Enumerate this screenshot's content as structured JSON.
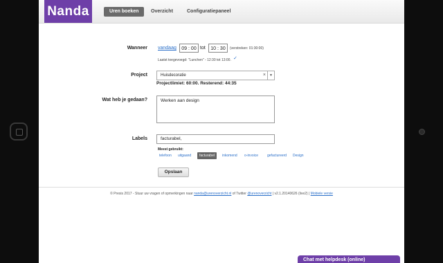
{
  "brand": {
    "logo": "Nanda",
    "accent": "#6e3fa8"
  },
  "nav": {
    "tabs": [
      {
        "label": "Uren boeken",
        "active": true
      },
      {
        "label": "Overzicht",
        "active": false
      },
      {
        "label": "Configuratiepaneel",
        "active": false
      }
    ]
  },
  "form": {
    "when": {
      "label": "Wanneer",
      "date_link": "vandaag",
      "from_h": "09",
      "from_m": "00",
      "to_label": "tot",
      "to_h": "10",
      "to_m": "30",
      "duration": "(verstreken: 01:30:00)",
      "last_added": "Laatst toegevoegd: \"Lunchen\" - 12:30 tot 13:00.",
      "check_icon": "checkmark-icon"
    },
    "project": {
      "label": "Project",
      "value": "Huisdecoratie",
      "limit": "Projectlimiet: 60:00. Resterend: 44:35"
    },
    "description": {
      "label": "Wat heb je gedaan?",
      "value": "Werken aan design"
    },
    "labels": {
      "label": "Labels",
      "value": "facturabel,",
      "most_used_label": "Meest gebruikt:",
      "tags": [
        {
          "text": "telefoon",
          "selected": false
        },
        {
          "text": "uitgaand",
          "selected": false
        },
        {
          "text": "facturabel",
          "selected": true
        },
        {
          "text": "inkomend",
          "selected": false
        },
        {
          "text": "o-invoice",
          "selected": false
        },
        {
          "text": "gefactureerd",
          "selected": false
        },
        {
          "text": "Design",
          "selected": false
        }
      ]
    },
    "save_label": "Opslaan"
  },
  "footer": {
    "text_1": "© Presis 2017 - Stuur uw vragen of opmerkingen naar ",
    "email": "nanda@urenoverzicht.nl",
    "text_2": " of Twitter ",
    "twitter": "@urenoverzicht",
    "version": " | v2.1.20140626 (live2) | ",
    "mobile_link": "Mobiele versie"
  },
  "chat": {
    "label": "Chat met helpdesk (online)"
  }
}
